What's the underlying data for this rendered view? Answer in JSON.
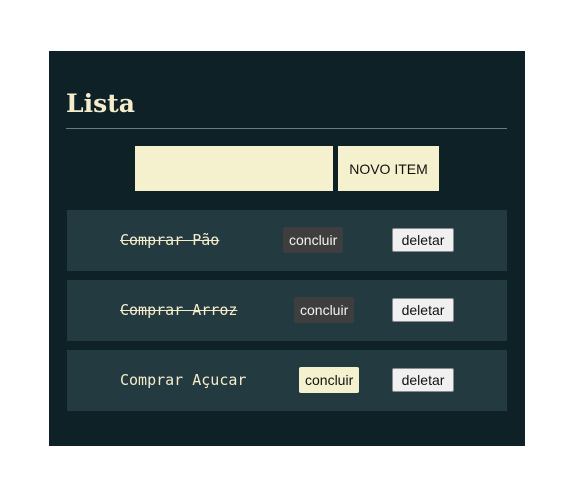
{
  "app": {
    "title": "Lista"
  },
  "new_item": {
    "input_value": "",
    "input_placeholder": "",
    "button_label": "NOVO ITEM"
  },
  "items": [
    {
      "label": "Comprar Pão",
      "done": true,
      "conclude_label": "concluir",
      "delete_label": "deletar"
    },
    {
      "label": "Comprar Arroz",
      "done": true,
      "conclude_label": "concluir",
      "delete_label": "deletar"
    },
    {
      "label": "Comprar Açucar",
      "done": false,
      "conclude_label": "concluir",
      "delete_label": "deletar"
    }
  ],
  "colors": {
    "background": "#0d2127",
    "item_background": "#233a40",
    "accent": "#f5f0cd",
    "done_button": "#3e3e3e"
  }
}
